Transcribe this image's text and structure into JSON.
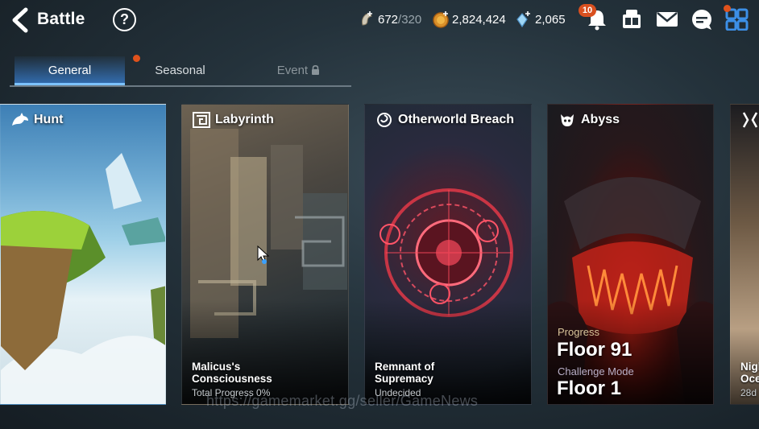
{
  "header": {
    "title": "Battle",
    "help_label": "?"
  },
  "resources": {
    "stamina_value": "672",
    "stamina_max": "/320",
    "gold_value": "2,824,424",
    "skystone_value": "2,065"
  },
  "notifications": {
    "count": "10"
  },
  "tabs": [
    {
      "label": "General"
    },
    {
      "label": "Seasonal"
    },
    {
      "label": "Event"
    }
  ],
  "cards": {
    "hunt": {
      "title": "Hunt"
    },
    "labyrinth": {
      "title": "Labyrinth",
      "subtitle_line1": "Malicus's",
      "subtitle_line2": "Consciousness",
      "note": "Total Progress 0%"
    },
    "breach": {
      "title": "Otherworld Breach",
      "subtitle_line1": "Remnant of",
      "subtitle_line2": "Supremacy",
      "note": "Undecided"
    },
    "abyss": {
      "title": "Abyss",
      "progress_label": "Progress",
      "progress_value": "Floor 91",
      "challenge_label": "Challenge Mode",
      "challenge_value": "Floor 1"
    },
    "fifth": {
      "subtitle_line1": "Nigh",
      "subtitle_line2": "Oce",
      "note": "28d"
    }
  },
  "watermark": "https://gamemarket.gg/seller/GameNews",
  "colors": {
    "accent_tab": "#7cc2ff",
    "badge": "#d9501f"
  }
}
